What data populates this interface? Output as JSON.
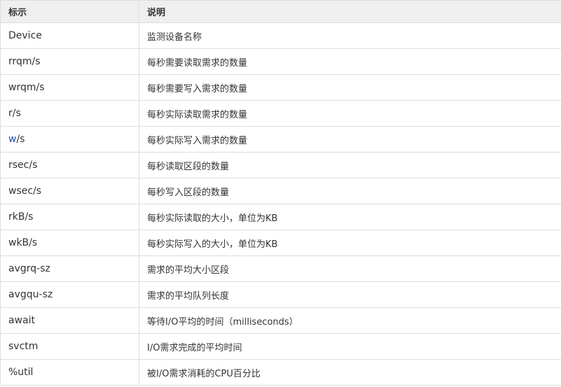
{
  "table": {
    "headers": [
      "标示",
      "说明"
    ],
    "rows": [
      {
        "field": "Device",
        "desc": "监测设备名称"
      },
      {
        "field": "rrqm/s",
        "desc": "每秒需要读取需求的数量"
      },
      {
        "field": "wrqm/s",
        "desc": "每秒需要写入需求的数量"
      },
      {
        "field": "r/s",
        "desc": "每秒实际读取需求的数量"
      },
      {
        "field_highlight": "w",
        "field_rest": "/s",
        "desc": "每秒实际写入需求的数量"
      },
      {
        "field": "rsec/s",
        "desc": "每秒读取区段的数量"
      },
      {
        "field": "wsec/s",
        "desc": "每秒写入区段的数量"
      },
      {
        "field": "rkB/s",
        "desc": "每秒实际读取的大小，单位为KB"
      },
      {
        "field": "wkB/s",
        "desc": "每秒实际写入的大小，单位为KB"
      },
      {
        "field": "avgrq-sz",
        "desc": "需求的平均大小区段"
      },
      {
        "field": "avgqu-sz",
        "desc": "需求的平均队列长度"
      },
      {
        "field": "await",
        "desc": "等待I/O平均的时间（milliseconds）"
      },
      {
        "field": "svctm",
        "desc": "I/O需求完成的平均时间"
      },
      {
        "field": "%util",
        "desc": "被I/O需求消耗的CPU百分比"
      }
    ],
    "highlight_color": "#1a4fa3"
  }
}
